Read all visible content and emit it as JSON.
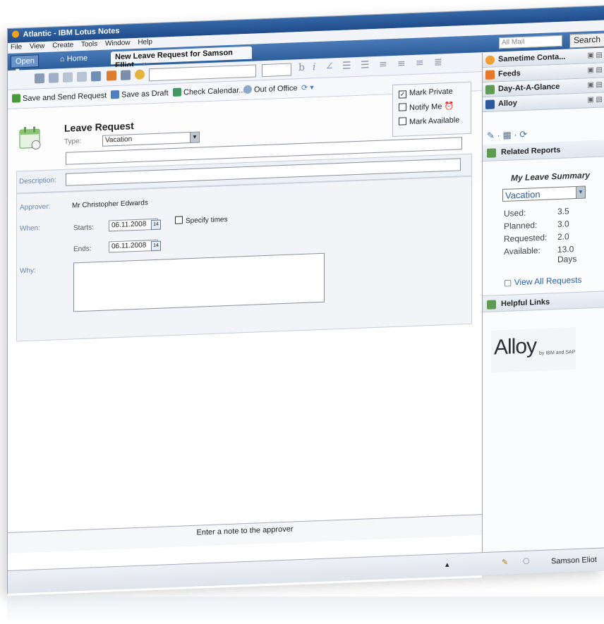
{
  "window": {
    "title": "Atlantic - IBM Lotus Notes",
    "menu": [
      "File",
      "View",
      "Create",
      "Tools",
      "Window",
      "Help"
    ]
  },
  "tabs": {
    "open_label": "Open",
    "home_label": "Home",
    "active_label": "New Leave Request for Samson Elliot",
    "close_symbol": "×"
  },
  "search": {
    "scope": "All Mail",
    "button": "Search"
  },
  "actions": {
    "save_send": "Save and Send Request",
    "save_draft": "Save as Draft",
    "check_calendar": "Check Calendar...",
    "out_of_office": "Out of Office"
  },
  "form": {
    "title": "Leave Request",
    "type_label": "Type:",
    "type_value": "Vacation",
    "mark_private": "Mark Private",
    "notify_me": "Notify Me",
    "mark_available": "Mark Available",
    "description_label": "Description:",
    "approver_label": "Approver:",
    "approver_value": "Mr Christopher Edwards",
    "when_label": "When:",
    "starts_label": "Starts:",
    "starts_value": "06.11.2008",
    "ends_label": "Ends:",
    "ends_value": "06.11.2008",
    "specify_times": "Specify times",
    "why_label": "Why:",
    "calendar_glyph": "14"
  },
  "note_bar": "Enter a note to the approver",
  "sidebar": {
    "panels": [
      "Sametime Conta...",
      "Feeds",
      "Day-At-A-Glance",
      "Alloy"
    ],
    "related_reports": "Related Reports",
    "summary_title": "My Leave Summary",
    "leave_type": "Vacation",
    "stats": [
      {
        "label": "Used:",
        "value": "3.5"
      },
      {
        "label": "Planned:",
        "value": "3.0"
      },
      {
        "label": "Requested:",
        "value": "2.0"
      },
      {
        "label": "Available:",
        "value": "13.0 Days"
      }
    ],
    "view_all": "View All Requests",
    "helpful_links": "Helpful Links",
    "logo_text": "Alloy",
    "logo_sub": "by IBM and SAP"
  },
  "status": {
    "user": "Samson Eliot"
  },
  "colors": {
    "titlebar": "#1f4c8b",
    "link": "#2d62b0",
    "label": "#6a84a8"
  }
}
